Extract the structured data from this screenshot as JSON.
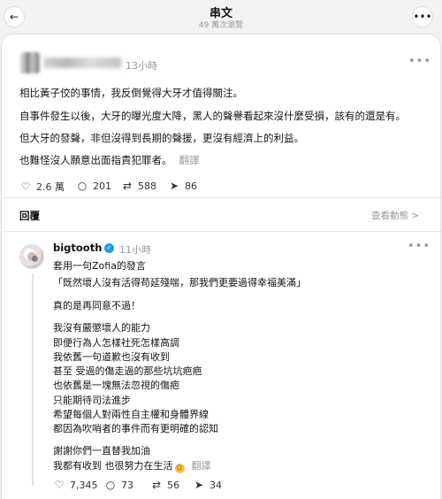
{
  "header": {
    "back_icon": "chevron-left-icon",
    "title": "串文",
    "subtitle": "49 萬次瀏覽",
    "more_icon": "more-horizontal-icon"
  },
  "post": {
    "time": "13小時",
    "lines": [
      "相比黃子佼的事情，我反倒覺得大牙才值得關注。",
      "自事件發生以後，大牙的曝光度大降，黑人的聲譽看起來沒什麼受損，該有的還是有。",
      "但大牙的發聲，非但沒得到長期的聲援，更沒有經濟上的利益。",
      "也難怪沒人願意出面指責犯罪者。"
    ],
    "translate": "翻譯",
    "likes": "2.6 萬",
    "comments": "201",
    "reposts": "588",
    "shares": "86"
  },
  "replies_bar": {
    "label": "回覆",
    "view_activity": "查看動態 >"
  },
  "reply": {
    "username": "bigtooth",
    "time": "11小時",
    "lines": [
      "套用一句Zofia的發言",
      "「既然壞人沒有活得苟延殘喘，那我們更要過得幸福美滿」",
      "真的是再同意不過！",
      "我沒有嚴懲壞人的能力",
      "即便行為人怎樣社死怎樣高調",
      "我依舊一句道歉也沒有收到",
      "甚至 受過的傷走過的那些坑坑疤疤",
      "也依舊是一塊無法忽視的傷疤",
      "只能期待司法進步",
      "希望每個人對兩性自主權和身體界線",
      "都因為吹哨者的事件而有更明確的認知",
      "謝謝你們一直替我加油",
      "我都有收到 也很努力在生活"
    ],
    "emoji": "smiling-face-emoji",
    "translate": "翻譯",
    "likes": "7,345",
    "comments": "73",
    "reposts": "56",
    "shares": "34"
  },
  "icons": {
    "like": "heart-icon",
    "comment": "comment-bubble-icon",
    "repost": "repost-icon",
    "share": "send-icon",
    "verified": "verified-badge-icon"
  },
  "colors": {
    "background": "#f2f2f2",
    "card": "#ffffff",
    "muted": "#9a9a9a",
    "verified": "#1d9bf0"
  }
}
